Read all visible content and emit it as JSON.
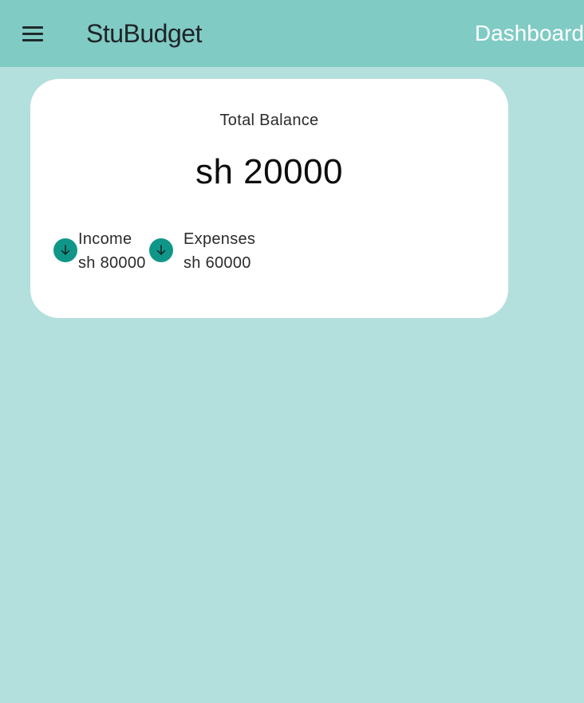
{
  "appbar": {
    "title": "StuBudget",
    "nav_link": "Dashboard",
    "background_color": "#80cbc4",
    "menu_icon": "hamburger-menu-icon"
  },
  "balance_card": {
    "label": "Total Balance",
    "value": "sh 20000",
    "income": {
      "label": "Income",
      "value": "sh 80000",
      "icon": "arrow-down-icon",
      "icon_color": "#109688"
    },
    "expenses": {
      "label": "Expenses",
      "value": "sh 60000",
      "icon": "arrow-down-icon",
      "icon_color": "#109688"
    }
  },
  "page_background_color": "#b3e0dc"
}
